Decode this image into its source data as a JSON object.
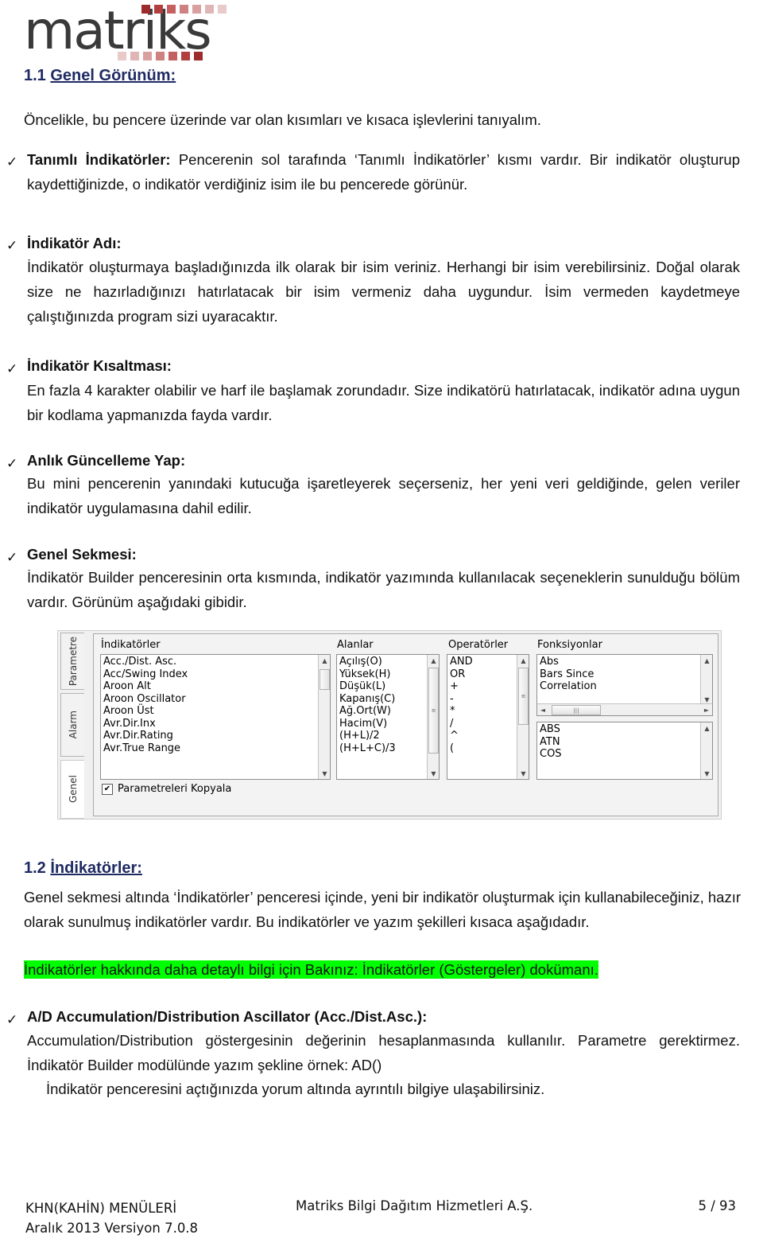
{
  "logo": {
    "wordmark": "matriks",
    "dot_colors_top": [
      "#9e2b2b",
      "#b23f3f",
      "#c46060",
      "#cf8080",
      "#d9a0a0",
      "#e0b5b5",
      "#e8caca"
    ],
    "dot_colors_bottom": [
      "#e8caca",
      "#e0b5b5",
      "#d9a0a0",
      "#cf8080",
      "#c46060",
      "#b23f3f",
      "#9e2b2b"
    ],
    "accent_color": "#9e2b2b",
    "text_color": "#3a3a3a"
  },
  "headings": {
    "s11_num": "1.1",
    "s11_title": "Genel Görünüm:",
    "s12_num": "1.2",
    "s12_title": "İndikatörler:",
    "color": "#1f2a63"
  },
  "intro": "Öncelikle, bu pencere üzerinde var olan kısımları ve kısaca işlevlerini tanıyalım.",
  "bullets": [
    {
      "marker": "check-icon",
      "title": "Tanımlı İndikatörler:",
      "title_inline": true,
      "body": "Pencerenin sol tarafında ‘Tanımlı İndikatörler’ kısmı vardır. Bir indikatör oluşturup kaydettiğinizde, o indikatör verdiğiniz isim ile bu pencerede görünür."
    },
    {
      "marker": "check-icon",
      "title": "İndikatör Adı:",
      "title_inline": false,
      "body": "İndikatör oluşturmaya başladığınızda ilk olarak bir isim veriniz. Herhangi bir isim verebilirsiniz. Doğal olarak size ne hazırladığınızı hatırlatacak bir isim vermeniz daha uygundur. İsim vermeden kaydetmeye çalıştığınızda program sizi uyaracaktır."
    },
    {
      "marker": "check-icon",
      "title": "İndikatör Kısaltması:",
      "title_inline": false,
      "body": "En fazla 4 karakter olabilir ve harf ile başlamak zorundadır. Size indikatörü hatırlatacak, indikatör adına uygun bir kodlama yapmanızda fayda vardır."
    },
    {
      "marker": "check-icon",
      "title": "Anlık Güncelleme Yap:",
      "title_inline": false,
      "body": "Bu mini pencerenin yanındaki kutucuğa işaretleyerek seçerseniz, her yeni veri geldiğinde, gelen veriler indikatör uygulamasına dahil edilir."
    },
    {
      "marker": "check-icon",
      "title": "Genel Sekmesi:",
      "title_inline": false,
      "body": "İndikatör Builder penceresinin orta kısmında, indikatör yazımında kullanılacak seçeneklerin sunulduğu bölüm vardır. Görünüm aşağıdaki gibidir."
    }
  ],
  "section12": {
    "body": "Genel sekmesi altında ‘İndikatörler’ penceresi içinde, yeni bir indikatör oluşturmak için kullanabileceğiniz, hazır olarak sunulmuş indikatörler vardır. Bu indikatörler ve yazım şekilleri kısaca aşağıdadır.",
    "highlight": "İndikatörler hakkında daha detaylı bilgi için Bakınız: İndikatörler (Göstergeler) dokümanı.",
    "highlight_color": "#00ff00"
  },
  "ad_section": {
    "marker": "check-icon",
    "title": "A/D  Accumulation/Distribution Ascillator (Acc./Dist.Asc.):",
    "body": "Accumulation/Distribution göstergesinin değerinin hesaplanmasında kullanılır. Parametre gerektirmez. İndikatör Builder modülünde yazım şekline örnek: AD()",
    "note": "İndikatör penceresini açtığınızda yorum altında ayrıntılı bilgiye ulaşabilirsiniz."
  },
  "screenshot": {
    "vertical_tabs": [
      "Parametre",
      "Alarm",
      "Genel"
    ],
    "columns": {
      "indikatorler_label": "İndikatörler",
      "alanlar_label": "Alanlar",
      "operatorler_label": "Operatörler",
      "fonksiyonlar_label": "Fonksiyonlar"
    },
    "indikatorler_items": [
      "Acc./Dist. Asc.",
      "Acc/Swing Index",
      "Aroon Alt",
      "Aroon Oscillator",
      "Aroon Üst",
      "Avr.Dir.Inx",
      "Avr.Dir.Rating",
      "Avr.True Range"
    ],
    "alanlar_items": [
      "Açılış(O)",
      "Yüksek(H)",
      "Düşük(L)",
      "Kapanış(C)",
      "Ağ.Ort(W)",
      "Hacim(V)",
      "(H+L)/2",
      "(H+L+C)/3"
    ],
    "operatorler_items": [
      "AND",
      "OR",
      "+",
      "-",
      "*",
      "/",
      "^",
      "("
    ],
    "fonksiyonlar_items": [
      "Abs",
      "Bars Since",
      "Correlation"
    ],
    "fonksiyonlar2_items": [
      "ABS",
      "ATN",
      "COS"
    ],
    "checkbox": {
      "label": "Parametreleri Kopyala",
      "checked": true,
      "glyph": "✔"
    },
    "scroll_glyphs": {
      "up": "▲",
      "down": "▼",
      "left": "◄",
      "right": "►",
      "grip": "|||"
    }
  },
  "footer": {
    "left_line1": "KHN(KAHİN) MENÜLERİ",
    "left_line2": "Aralık 2013 Versiyon 7.0.8",
    "center": "Matriks Bilgi Dağıtım Hizmetleri A.Ş.",
    "page": "5 / 93"
  }
}
